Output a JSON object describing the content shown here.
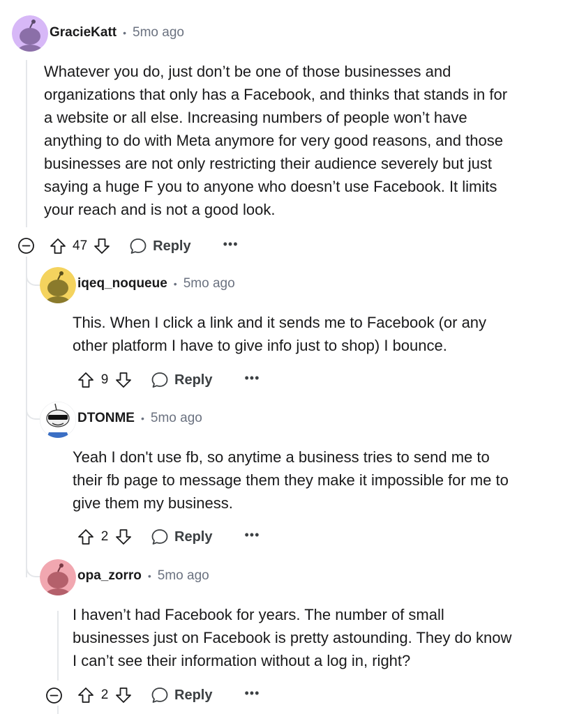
{
  "comments": [
    {
      "username": "GracieKatt",
      "separator": "•",
      "time": "5mo ago",
      "lines": [
        "Whatever you do, just don’t be one of those businesses and",
        "organizations that only has a Facebook, and thinks that stands in for",
        "a website or all else. Increasing numbers of people won’t have",
        "anything to do with Meta anymore for very good reasons, and those",
        "businesses are not only restricting their audience severely but just",
        "saying a huge F you to anyone who doesn’t use Facebook. It limits",
        "your reach and is not a good look."
      ],
      "votes": "47",
      "reply_label": "Reply",
      "more_label": "•••",
      "avatar_color": "#d7b8f7"
    },
    {
      "username": "iqeq_noqueue",
      "separator": "•",
      "time": "5mo ago",
      "lines": [
        "This. When I click a link and it sends me to Facebook (or any",
        "other platform I have to give info just to shop) I bounce."
      ],
      "votes": "9",
      "reply_label": "Reply",
      "more_label": "•••",
      "avatar_color": "#f4d35e"
    },
    {
      "username": "DTONME",
      "separator": "•",
      "time": "5mo ago",
      "lines": [
        "Yeah I don't use fb, so anytime a business tries to send me to",
        "their fb page to message them they make it impossible for me to",
        "give them my business."
      ],
      "votes": "2",
      "reply_label": "Reply",
      "more_label": "•••",
      "avatar_color": "#ffffff"
    },
    {
      "username": "opa_zorro",
      "separator": "•",
      "time": "5mo ago",
      "lines": [
        "I haven’t had Facebook for years. The number of small",
        "businesses just on Facebook is pretty astounding. They do know",
        "I can’t see their information without a log in, right?"
      ],
      "votes": "2",
      "reply_label": "Reply",
      "more_label": "•••",
      "avatar_color": "#f1a7b0"
    }
  ],
  "colors": {
    "text": "#1a1a1b",
    "muted": "#6b7280",
    "thread": "#e5e7ea"
  }
}
